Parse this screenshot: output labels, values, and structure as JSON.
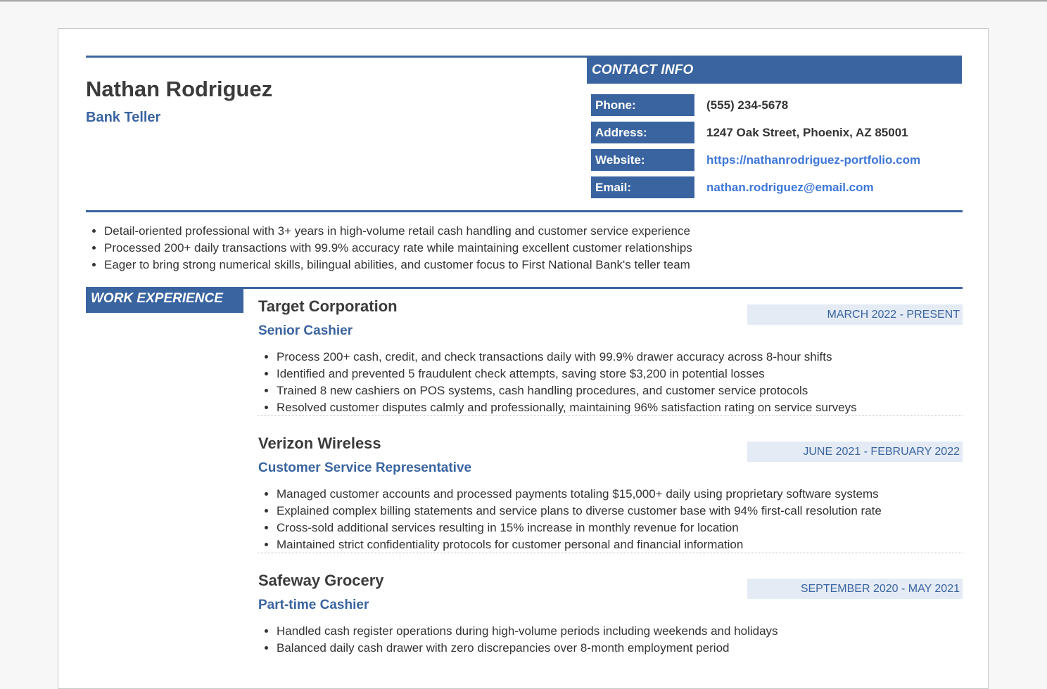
{
  "header": {
    "name": "Nathan Rodriguez",
    "title": "Bank Teller"
  },
  "contact": {
    "heading": "CONTACT INFO",
    "items": [
      {
        "label": "Phone:",
        "value": "(555) 234-5678"
      },
      {
        "label": "Address:",
        "value": "1247 Oak Street, Phoenix, AZ 85001"
      },
      {
        "label": "Website:",
        "value": "https://nathanrodriguez-portfolio.com"
      },
      {
        "label": "Email:",
        "value": "nathan.rodriguez@email.com"
      }
    ]
  },
  "summary": [
    "Detail-oriented professional with 3+ years in high-volume retail cash handling and customer service experience",
    "Processed 200+ daily transactions with 99.9% accuracy rate while maintaining excellent customer relationships",
    "Eager to bring strong numerical skills, bilingual abilities, and customer focus to First National Bank's teller team"
  ],
  "work": {
    "heading": "WORK EXPERIENCE",
    "jobs": [
      {
        "company": "Target Corporation",
        "role": "Senior Cashier",
        "dates": "MARCH 2022 - PRESENT",
        "bullets": [
          "Process 200+ cash, credit, and check transactions daily with 99.9% drawer accuracy across 8-hour shifts",
          "Identified and prevented 5 fraudulent check attempts, saving store $3,200 in potential losses",
          "Trained 8 new cashiers on POS systems, cash handling procedures, and customer service protocols",
          "Resolved customer disputes calmly and professionally, maintaining 96% satisfaction rating on service surveys"
        ]
      },
      {
        "company": "Verizon Wireless",
        "role": "Customer Service Representative",
        "dates": "JUNE 2021 - FEBRUARY 2022",
        "bullets": [
          "Managed customer accounts and processed payments totaling $15,000+ daily using proprietary software systems",
          "Explained complex billing statements and service plans to diverse customer base with 94% first-call resolution rate",
          "Cross-sold additional services resulting in 15% increase in monthly revenue for location",
          "Maintained strict confidentiality protocols for customer personal and financial information"
        ]
      },
      {
        "company": "Safeway Grocery",
        "role": "Part-time Cashier",
        "dates": "SEPTEMBER 2020 - MAY 2021",
        "bullets": [
          "Handled cash register operations during high-volume periods including weekends and holidays",
          "Balanced daily cash drawer with zero discrepancies over 8-month employment period"
        ]
      }
    ]
  },
  "colors": {
    "accent": "#3a64a0",
    "link": "#3d76d8",
    "date_bg": "#e4ebf5",
    "text": "#333333"
  }
}
